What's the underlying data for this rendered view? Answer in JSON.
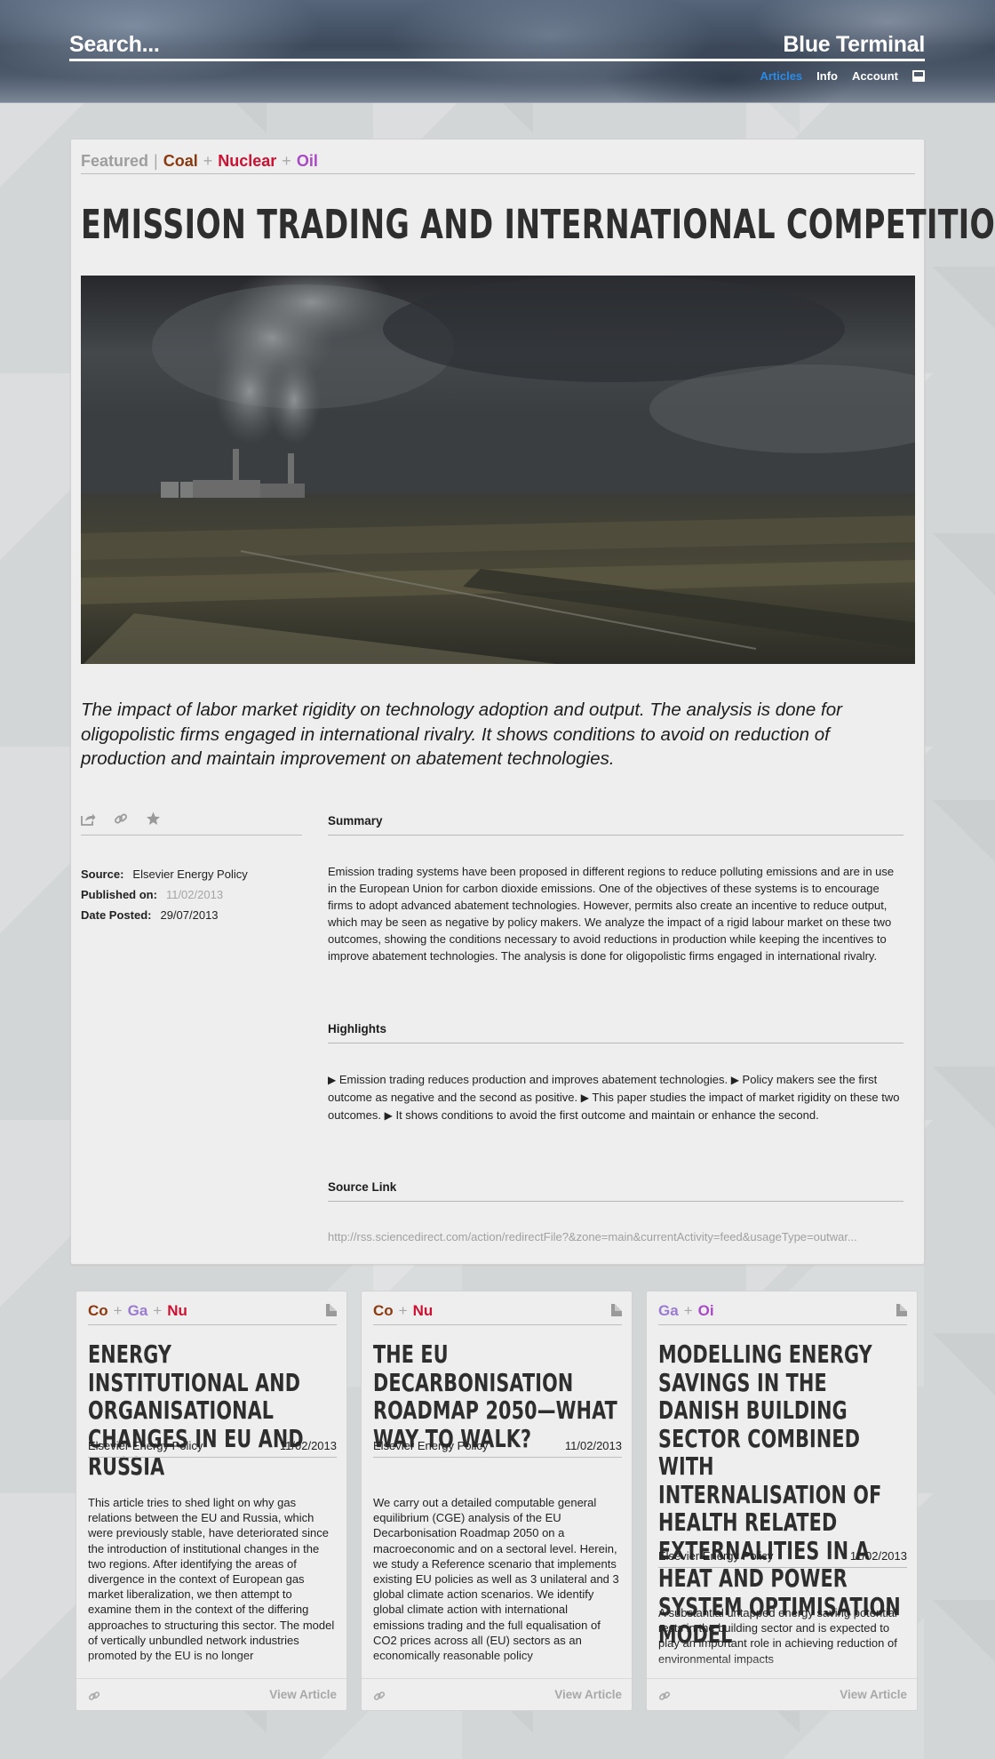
{
  "header": {
    "search_label": "Search...",
    "brand": "Blue Terminal",
    "nav": [
      {
        "label": "Articles",
        "active": true
      },
      {
        "label": "Info"
      },
      {
        "label": "Account"
      }
    ],
    "layout_icon": "layout-toggle-icon"
  },
  "article": {
    "categories": {
      "featured": "Featured",
      "sep": "|",
      "plus": "+",
      "coal": "Coal",
      "nuclear": "Nuclear",
      "oil": "Oil"
    },
    "title": "EMISSION TRADING AND INTERNATIONAL COMPETITION",
    "hero_icon": "coal-power-plant-photo",
    "lede": "The impact of labor market rigidity on technology adoption and output. The analysis is done for oligopolistic firms engaged in international rivalry. It shows conditions to avoid on reduction of production and maintain improvement on abatement technologies.",
    "actions": {
      "share": "share-icon",
      "link": "link-icon",
      "favorite": "star-icon"
    },
    "meta": {
      "source_label": "Source:",
      "source": "Elsevier Energy Policy",
      "published_label": "Published on:",
      "published": "11/02/2013",
      "posted_label": "Date Posted:",
      "posted": "29/07/2013"
    },
    "summary_title": "Summary",
    "summary": "Emission trading systems have been proposed in different regions to reduce polluting emissions and are in use in the European Union for carbon dioxide emissions. One of the objectives of these systems is to encourage firms to adopt advanced abatement technologies. However, permits also create an incentive to reduce output, which may be seen as negative by policy makers. We analyze the impact of a rigid labour market on these two outcomes, showing the conditions necessary to avoid reductions in production while keeping the incentives to improve abatement technologies. The analysis is done for oligopolistic firms engaged in international rivalry.",
    "highlights_title": "Highlights",
    "highlights": [
      "Emission trading reduces production and improves abatement technologies.",
      "Policy makers see the first outcome as negative and the second as positive.",
      "This paper studies the impact of market rigidity on these two outcomes.",
      "It shows conditions to avoid the first outcome and maintain or enhance the second."
    ],
    "highlight_marker": "▶",
    "source_link_title": "Source Link",
    "source_link": "http://rss.sciencedirect.com/action/redirectFile?&zone=main&currentActivity=feed&usageType=outwar..."
  },
  "cards": [
    {
      "tags": [
        {
          "label": "Co",
          "kind": "coal"
        },
        {
          "label": "Ga",
          "kind": "gas"
        },
        {
          "label": "Nu",
          "kind": "nuclear"
        }
      ],
      "title": "ENERGY INSTITUTIONAL AND ORGANISATIONAL CHANGES IN EU AND RUSSIA",
      "source": "Elsevier Energy Policy",
      "date": "11/02/2013",
      "body": "This article tries to shed light on why gas relations between the EU and Russia, which were previously stable, have deteriorated since the introduction of institutional changes in the two regions. After identifying the areas of divergence in the context of European gas market liberalization, we then attempt to examine them in the context of the differing approaches to structuring this sector. The model of vertically unbundled network industries promoted by the EU is no longer",
      "view_label": "View Article"
    },
    {
      "tags": [
        {
          "label": "Co",
          "kind": "coal"
        },
        {
          "label": "Nu",
          "kind": "nuclear"
        }
      ],
      "title": "THE EU DECARBONISATION ROADMAP 2050—WHAT WAY TO WALK?",
      "source": "Elsevier Energy Policy",
      "date": "11/02/2013",
      "body": "We carry out a detailed computable general equilibrium (CGE) analysis of the EU Decarbonisation Roadmap 2050 on a macroeconomic and on a sectoral level. Herein, we study a Reference scenario that implements existing EU policies as well as 3 unilateral and 3 global climate action scenarios. We identify global climate action with international emissions trading and the full equalisation of CO2 prices across all (EU) sectors as an economically reasonable policy",
      "view_label": "View Article"
    },
    {
      "tags": [
        {
          "label": "Ga",
          "kind": "gas"
        },
        {
          "label": "Oi",
          "kind": "oil"
        }
      ],
      "title": "MODELLING ENERGY SAVINGS IN THE DANISH BUILDING SECTOR COMBINED WITH INTERNALISATION OF HEALTH RELATED EXTERNALITIES IN A HEAT AND POWER SYSTEM OPTIMISATION MODEL",
      "source": "Elsevier Energy Policy",
      "date": "11/02/2013",
      "body": "A substantial untapped energy saving potential rests in the building sector and is expected to play an important role in achieving reduction of environmental impacts",
      "view_label": "View Article"
    }
  ],
  "colors": {
    "coal": "#8b3a10",
    "nuclear": "#cc1133",
    "oil": "#a84ac4",
    "gas": "#9a7bd0",
    "active_nav": "#2a8ae8"
  }
}
